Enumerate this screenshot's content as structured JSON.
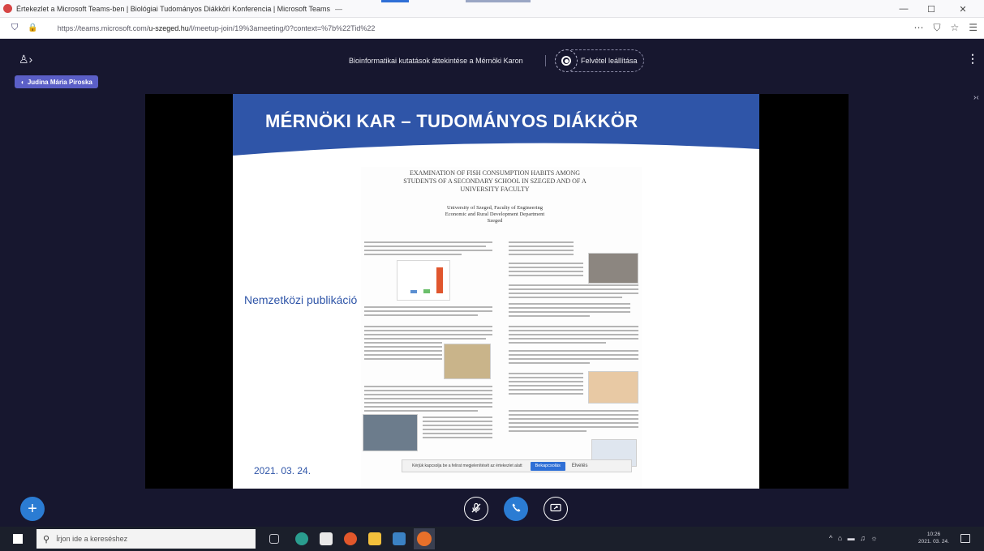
{
  "browser": {
    "tab_title": "Értekezlet a Microsoft Teams-ben | Biológiai Tudományos Diákköri Konferencia | Microsoft Teams",
    "tab_close": "—",
    "url_prefix": "https://teams.microsoft.com/",
    "url_domain": "u-szeged.hu",
    "url_rest": "/l/meetup-join/19%3ameeting/0?context=%7b%22Tid%22",
    "toolbar_icons": [
      "more-icon",
      "pocket-icon",
      "star-icon",
      "menu-icon"
    ],
    "window_controls": {
      "minimize": "—",
      "maximize": "☐",
      "close": "✕"
    }
  },
  "meeting": {
    "title": "Bioinformatikai kutatások áttekintése a Mérnöki Karon",
    "recording_label": "Felvétel leállítása",
    "presenter": "Judina Mária Piroska",
    "more": "⋮"
  },
  "slide": {
    "banner_title": "MÉRNÖKI KAR – TUDOMÁNYOS DIÁKKÖR",
    "left_label": "Nemzetközi publikáció",
    "date": "2021. 03. 24.",
    "poster": {
      "title": "EXAMINATION OF FISH CONSUMPTION HABITS AMONG STUDENTS OF A SECONDARY SCHOOL IN SZEGED AND OF A UNIVERSITY FACULTY",
      "authors": "University of Szeged, Faculty of Engineering",
      "department": "Economic and Rural Development Department",
      "city": "Szeged"
    },
    "notice": {
      "text": "Kérjük kapcsolja be a felirat megjelenítését az értekezlet alatt",
      "button": "Bekapcsolás",
      "close": "Elvetés"
    }
  },
  "controls": {
    "add": "+",
    "mic": "🎙",
    "hangup": "✆",
    "share": "⧉"
  },
  "taskbar": {
    "search_placeholder": "Írjon ide a kereséshez",
    "tray": "^ ⌂ ▬ ♫ ☼",
    "time": "10:26",
    "date": "2021. 03. 24."
  },
  "colors": {
    "app_background": "#17172f",
    "accent": "#2b7cd3",
    "banner": "#2f55a8",
    "presenter_badge": "#5b5fc7"
  }
}
